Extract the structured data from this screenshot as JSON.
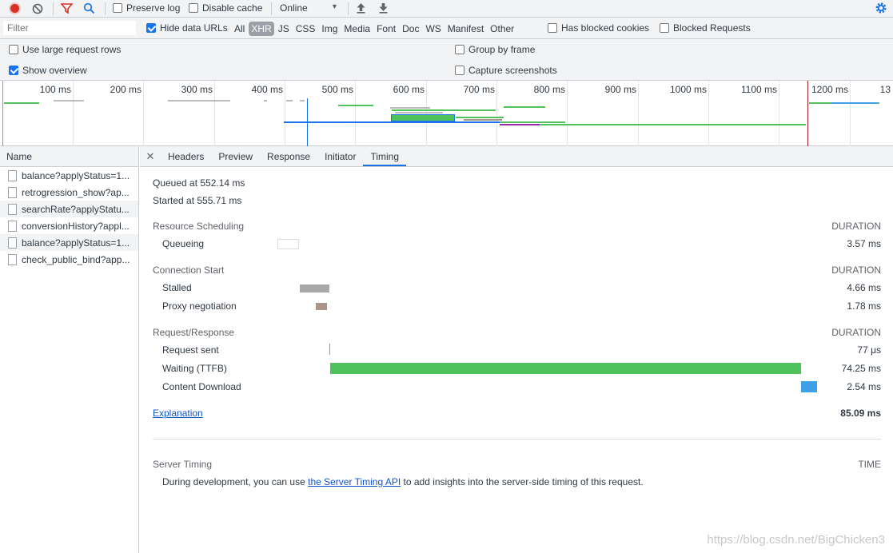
{
  "toolbar": {
    "preserve_log": "Preserve log",
    "disable_cache": "Disable cache",
    "throttling": "Online"
  },
  "filterbar": {
    "placeholder": "Filter",
    "hide_data_urls": "Hide data URLs",
    "types": [
      "All",
      "XHR",
      "JS",
      "CSS",
      "Img",
      "Media",
      "Font",
      "Doc",
      "WS",
      "Manifest",
      "Other"
    ],
    "active_type": "XHR",
    "has_blocked_cookies": "Has blocked cookies",
    "blocked_requests": "Blocked Requests"
  },
  "settings": {
    "large_rows": "Use large request rows",
    "show_overview": "Show overview",
    "group_by_frame": "Group by frame",
    "capture_screenshots": "Capture screenshots"
  },
  "overview": {
    "ticks": [
      "100 ms",
      "200 ms",
      "300 ms",
      "400 ms",
      "500 ms",
      "600 ms",
      "700 ms",
      "800 ms",
      "900 ms",
      "1000 ms",
      "1100 ms",
      "1200 ms",
      "13"
    ]
  },
  "requests": {
    "header": "Name",
    "items": [
      "balance?applyStatus=1...",
      "retrogression_show?ap...",
      "searchRate?applyStatu...",
      "conversionHistory?appl...",
      "balance?applyStatus=1...",
      "check_public_bind?app..."
    ]
  },
  "tabs": [
    "Headers",
    "Preview",
    "Response",
    "Initiator",
    "Timing"
  ],
  "timing": {
    "queued": "Queued at 552.14 ms",
    "started": "Started at 555.71 ms",
    "duration_label": "DURATION",
    "resource_scheduling": {
      "title": "Resource Scheduling",
      "phases": [
        {
          "name": "Queueing",
          "value": "3.57 ms"
        }
      ]
    },
    "connection_start": {
      "title": "Connection Start",
      "phases": [
        {
          "name": "Stalled",
          "value": "4.66 ms"
        },
        {
          "name": "Proxy negotiation",
          "value": "1.78 ms"
        }
      ]
    },
    "request_response": {
      "title": "Request/Response",
      "phases": [
        {
          "name": "Request sent",
          "value": "77 μs"
        },
        {
          "name": "Waiting (TTFB)",
          "value": "74.25 ms"
        },
        {
          "name": "Content Download",
          "value": "2.54 ms"
        }
      ]
    },
    "explanation": "Explanation",
    "total": "85.09 ms",
    "server_timing": {
      "title": "Server Timing",
      "time_label": "TIME",
      "text_before": "During development, you can use ",
      "link": "the Server Timing API",
      "text_after": " to add insights into the server-side timing of this request."
    }
  },
  "watermark": "https://blog.csdn.net/BigChicken3",
  "colors": {
    "record": "#d93025",
    "accent": "#1a73e8",
    "waiting": "#4fc25c",
    "download": "#3d9fe8",
    "stalled": "#a8a8a8",
    "proxy": "#a89488"
  }
}
